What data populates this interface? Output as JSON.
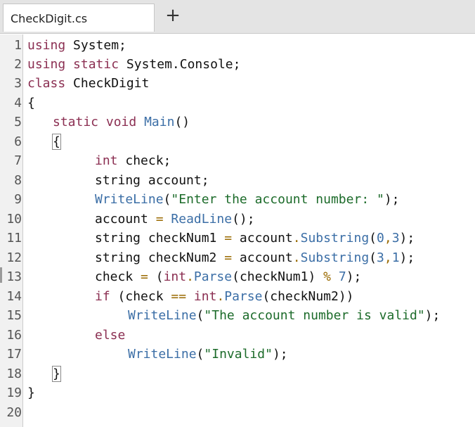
{
  "tab": {
    "title": "CheckDigit.cs",
    "add_label": "+"
  },
  "line_numbers": [
    "1",
    "2",
    "3",
    "4",
    "5",
    "6",
    "7",
    "8",
    "9",
    "10",
    "11",
    "12",
    "13",
    "14",
    "15",
    "16",
    "17",
    "18",
    "19",
    "20"
  ],
  "code": {
    "l1": [
      "using",
      " System;"
    ],
    "l2": [
      "using",
      " ",
      "static",
      " System.Console;"
    ],
    "l3": [
      "class",
      " CheckDigit"
    ],
    "l4": [
      "{"
    ],
    "l5": [
      "static",
      " ",
      "void",
      " ",
      "Main",
      "()"
    ],
    "l6": [
      "{"
    ],
    "l7": [
      "int",
      " check;"
    ],
    "l8": [
      "string account;"
    ],
    "l9": [
      "WriteLine",
      "(",
      "\"Enter the account number: \"",
      ");"
    ],
    "l10": [
      "account ",
      "=",
      " ",
      "ReadLine",
      "();"
    ],
    "l11": [
      "string checkNum1 ",
      "=",
      " account",
      ".",
      "Substring",
      "(",
      "0",
      ",",
      "3",
      ");"
    ],
    "l12": [
      "string checkNum2 ",
      "=",
      " account",
      ".",
      "Substring",
      "(",
      "3",
      ",",
      "1",
      ");"
    ],
    "l13": [
      "check ",
      "=",
      " (",
      "int",
      ".",
      "Parse",
      "(checkNum1) ",
      "%",
      " ",
      "7",
      ");"
    ],
    "l14": [
      "if",
      " (check ",
      "==",
      " ",
      "int",
      ".",
      "Parse",
      "(checkNum2))"
    ],
    "l15": [
      "WriteLine",
      "(",
      "\"The account number is valid\"",
      ");"
    ],
    "l16": [
      "else"
    ],
    "l17": [
      "WriteLine",
      "(",
      "\"Invalid\"",
      ");"
    ],
    "l18": [
      "}"
    ],
    "l19": [
      "}"
    ]
  }
}
